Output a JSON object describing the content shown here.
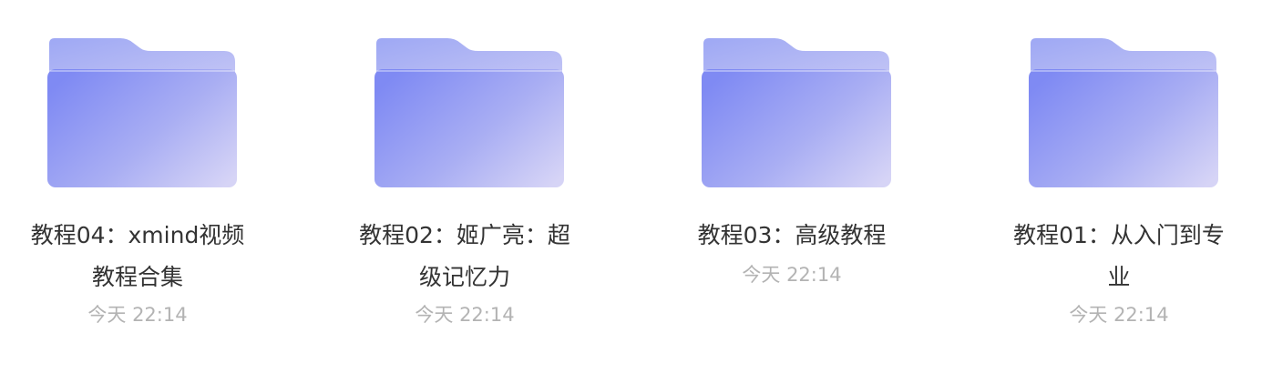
{
  "folders": [
    {
      "name": "教程04：xmind视频教程合集",
      "time": "今天 22:14"
    },
    {
      "name": "教程02：姬广亮：超级记忆力",
      "time": "今天 22:14"
    },
    {
      "name": "教程03：高级教程",
      "time": "今天 22:14"
    },
    {
      "name": "教程01：从入门到专业",
      "time": "今天 22:14"
    }
  ],
  "colors": {
    "folder_back": "#a8b0f5",
    "folder_front_start": "#7f8af3",
    "folder_front_end": "#d4d2f6",
    "name_text": "#333333",
    "time_text": "#b3b3b3"
  },
  "icons": [
    "folder-icon"
  ]
}
